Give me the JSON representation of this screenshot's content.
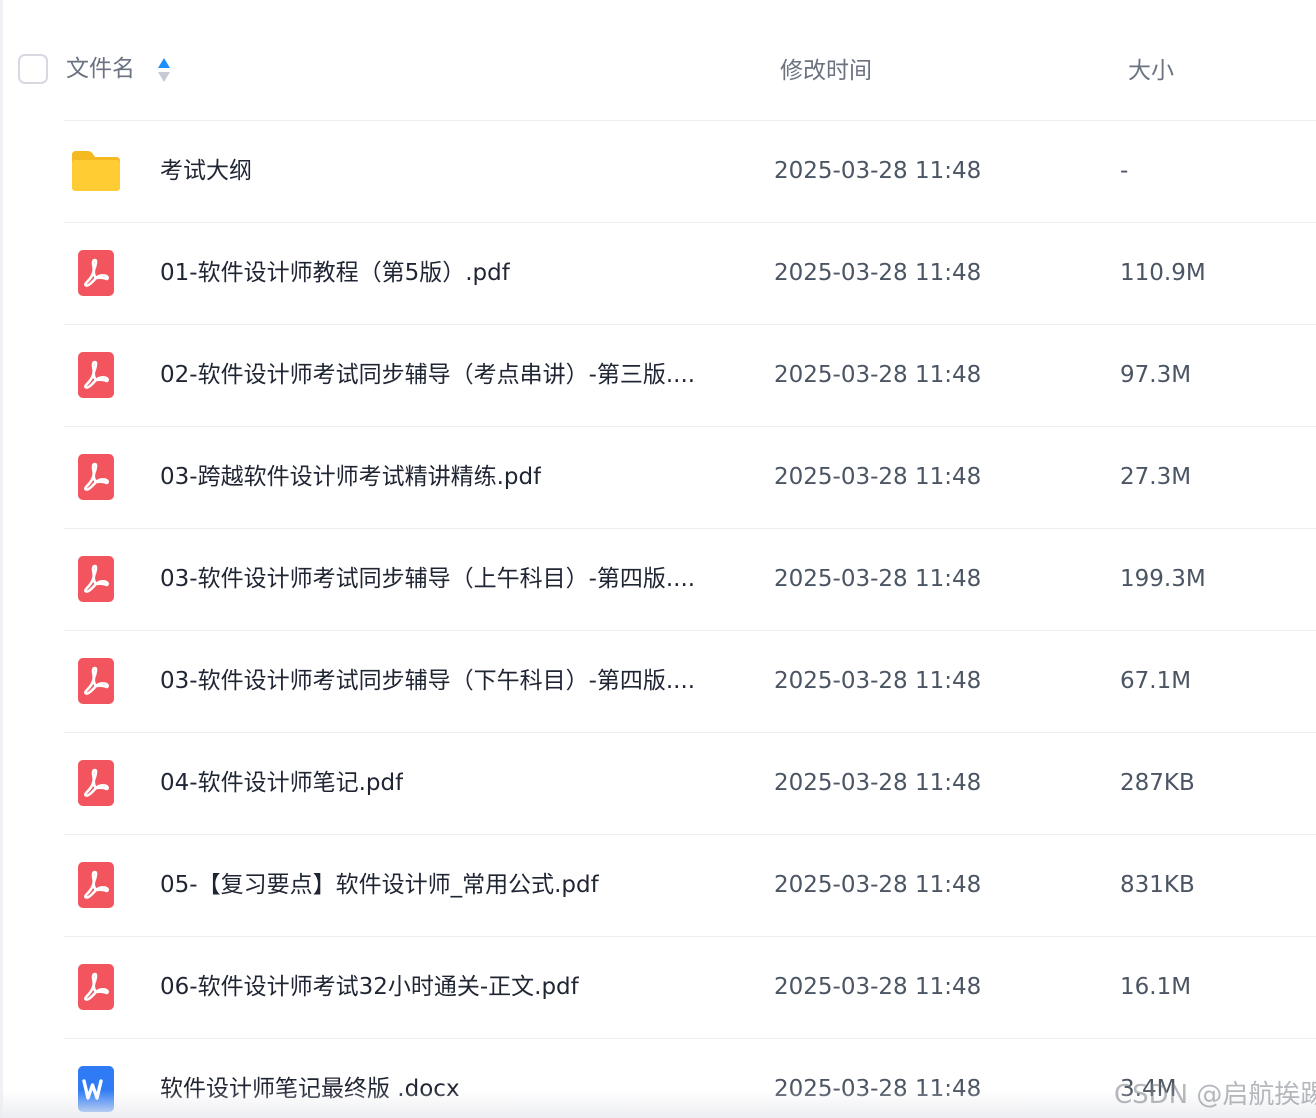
{
  "header": {
    "name_label": "文件名",
    "time_label": "修改时间",
    "size_label": "大小"
  },
  "files": [
    {
      "type": "folder",
      "name": "考试大纲",
      "time": "2025-03-28 11:48",
      "size": "-"
    },
    {
      "type": "pdf",
      "name": "01-软件设计师教程（第5版）.pdf",
      "time": "2025-03-28 11:48",
      "size": "110.9M"
    },
    {
      "type": "pdf",
      "name": "02-软件设计师考试同步辅导（考点串讲）-第三版....",
      "time": "2025-03-28 11:48",
      "size": "97.3M"
    },
    {
      "type": "pdf",
      "name": "03-跨越软件设计师考试精讲精练.pdf",
      "time": "2025-03-28 11:48",
      "size": "27.3M"
    },
    {
      "type": "pdf",
      "name": "03-软件设计师考试同步辅导（上午科目）-第四版....",
      "time": "2025-03-28 11:48",
      "size": "199.3M"
    },
    {
      "type": "pdf",
      "name": "03-软件设计师考试同步辅导（下午科目）-第四版....",
      "time": "2025-03-28 11:48",
      "size": "67.1M"
    },
    {
      "type": "pdf",
      "name": "04-软件设计师笔记.pdf",
      "time": "2025-03-28 11:48",
      "size": "287KB"
    },
    {
      "type": "pdf",
      "name": "05-【复习要点】软件设计师_常用公式.pdf",
      "time": "2025-03-28 11:48",
      "size": "831KB"
    },
    {
      "type": "pdf",
      "name": "06-软件设计师考试32小时通关-正文.pdf",
      "time": "2025-03-28 11:48",
      "size": "16.1M"
    },
    {
      "type": "word",
      "name": "软件设计师笔记最终版 .docx",
      "time": "2025-03-28 11:48",
      "size": "3.4M"
    }
  ],
  "icons": {
    "folder": "folder-icon",
    "pdf": "pdf-file-icon",
    "word": "word-file-icon",
    "sort": "sort-icon"
  },
  "colors": {
    "folder": "#FFCC33",
    "pdf": "#F2555D",
    "word": "#2F7BF5",
    "sort_active": "#1E8FFF",
    "sort_inactive": "#C5CAD3"
  },
  "watermark": "CSDN @启航挨踢"
}
